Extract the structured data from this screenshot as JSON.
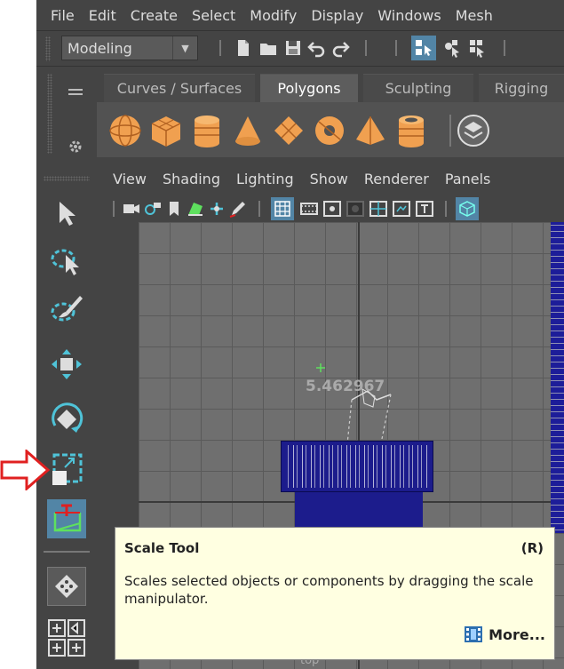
{
  "menubar": [
    "File",
    "Edit",
    "Create",
    "Select",
    "Modify",
    "Display",
    "Windows",
    "Mesh"
  ],
  "mode": {
    "label": "Modeling"
  },
  "shelf_tabs": [
    {
      "label": "Curves / Surfaces",
      "active": false
    },
    {
      "label": "Polygons",
      "active": true
    },
    {
      "label": "Sculpting",
      "active": false
    },
    {
      "label": "Rigging",
      "active": false
    }
  ],
  "viewport_menu": [
    "View",
    "Shading",
    "Lighting",
    "Show",
    "Renderer",
    "Panels"
  ],
  "viewport_label": "top",
  "manipulator_value": "5.462967",
  "tooltip": {
    "title": "Scale Tool",
    "shortcut": "(R)",
    "description": "Scales selected objects or components by dragging the scale manipulator.",
    "more": "More..."
  },
  "colors": {
    "accent_blue": "#5285a6",
    "tool_cyan": "#4fc3d8",
    "shelf_orange": "#f0a050",
    "indicator_red": "#e02020",
    "tooltip_bg": "#ffffe1",
    "object_navy": "#1c1c8c"
  }
}
